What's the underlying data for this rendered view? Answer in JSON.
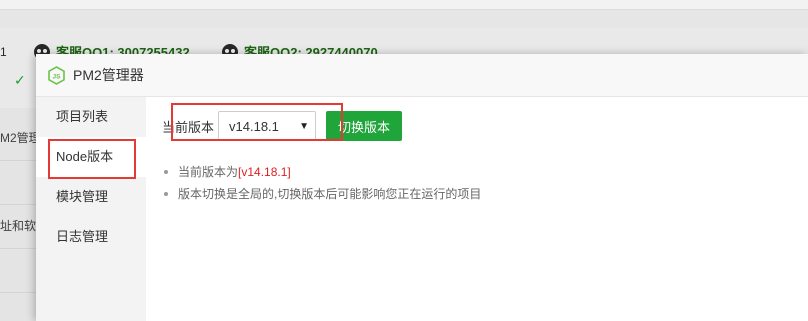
{
  "background": {
    "qq1": "客服QQ1: 3007255432",
    "qq2": "客服QQ2: 2927440070",
    "side_items": [
      "M2管理",
      "址和软件"
    ]
  },
  "modal": {
    "title": "PM2管理器",
    "menu": [
      "项目列表",
      "Node版本",
      "模块管理",
      "日志管理"
    ],
    "version_label": "当前版本",
    "selected_version": "v14.18.1",
    "switch_button": "切换版本",
    "note1_prefix": "当前版本为",
    "note1_value": "[v14.18.1]",
    "note2": "版本切换是全局的,切换版本后可能影响您正在运行的项目"
  },
  "colors": {
    "accent_green": "#20a53a",
    "highlight_red": "#e02020"
  }
}
